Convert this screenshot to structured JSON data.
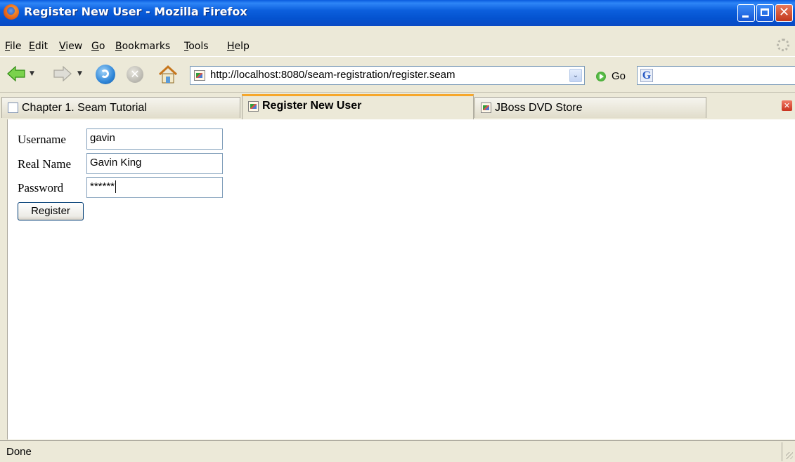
{
  "window": {
    "title": "Register New User - Mozilla Firefox"
  },
  "menu": {
    "items": [
      {
        "label": "File",
        "accel": "F",
        "rest": "ile"
      },
      {
        "label": "Edit",
        "accel": "E",
        "rest": "dit"
      },
      {
        "label": "View",
        "accel": "V",
        "rest": "iew"
      },
      {
        "label": "Go",
        "accel": "G",
        "rest": "o"
      },
      {
        "label": "Bookmarks",
        "accel": "B",
        "rest": "ookmarks"
      },
      {
        "label": "Tools",
        "accel": "T",
        "rest": "ools"
      },
      {
        "label": "Help",
        "accel": "H",
        "rest": "elp"
      }
    ]
  },
  "toolbar": {
    "url": "http://localhost:8080/seam-registration/register.seam",
    "go_label": "Go",
    "search_engine_icon": "G",
    "icons": [
      "back-arrow-icon",
      "forward-arrow-icon",
      "reload-icon",
      "stop-icon",
      "home-icon"
    ]
  },
  "tabs": [
    {
      "label": "Chapter 1. Seam Tutorial",
      "icon": "page-icon",
      "active": false
    },
    {
      "label": "Register New User",
      "icon": "image-icon",
      "active": true
    },
    {
      "label": "JBoss DVD Store",
      "icon": "image-icon",
      "active": false
    }
  ],
  "form": {
    "username_label": "Username",
    "username_value": "gavin",
    "realname_label": "Real Name",
    "realname_value": "Gavin King",
    "password_label": "Password",
    "password_value": "******",
    "register_label": "Register"
  },
  "status": {
    "text": "Done"
  },
  "colors": {
    "titlebar": "#0453D0",
    "active_tab_accent": "#F6A72B",
    "chrome": "#ECE9D8"
  }
}
